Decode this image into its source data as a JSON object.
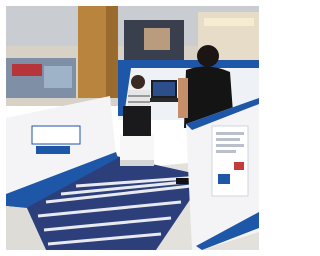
{
  "photo": {
    "booth_sign": "",
    "side_panel_text": "",
    "palette": {
      "booth_white": "#f4f4f6",
      "accent_blue": "#1e56a8",
      "mat_dark": "#2d3f7a",
      "mall_wood": "#b8843e",
      "ceiling": "#c9cdd2"
    }
  }
}
